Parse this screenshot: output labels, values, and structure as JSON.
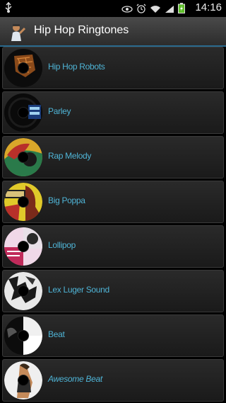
{
  "status_bar": {
    "time": "14:16",
    "icons": [
      "usb-icon",
      "eye-icon",
      "alarm-icon",
      "wifi-icon",
      "signal-icon",
      "battery-icon"
    ]
  },
  "action_bar": {
    "title": "Hip Hop Ringtones",
    "icon": "app-icon"
  },
  "colors": {
    "accent": "#2a6a8e",
    "label": "#4fb4d6"
  },
  "ringtones": [
    {
      "label": "Hip Hop Robots"
    },
    {
      "label": "Parley"
    },
    {
      "label": "Rap Melody"
    },
    {
      "label": "Big Poppa"
    },
    {
      "label": "Lollipop"
    },
    {
      "label": "Lex Luger Sound"
    },
    {
      "label": "Beat"
    },
    {
      "label": "Awesome Beat"
    }
  ]
}
